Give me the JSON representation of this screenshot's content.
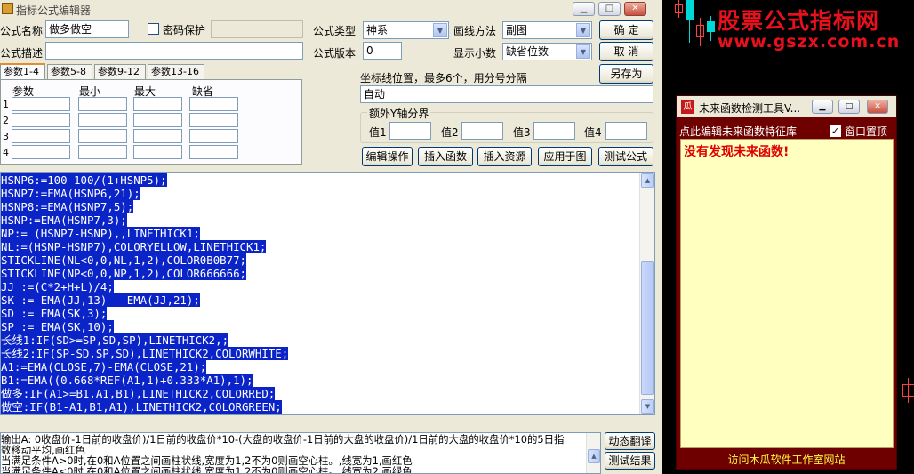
{
  "editor": {
    "title": "指标公式编辑器",
    "win_buttons": {
      "minimize": "▁",
      "maximize": "□",
      "close": "✕"
    },
    "name_label": "公式名称",
    "name_value": "做多做空",
    "password_label": "密码保护",
    "type_label": "公式类型",
    "type_value": "神系",
    "draw_label": "画线方法",
    "draw_value": "副图",
    "ok_label": "确  定",
    "desc_label": "公式描述",
    "version_label": "公式版本",
    "version_value": "0",
    "decimals_label": "显示小数",
    "decimals_value": "缺省位数",
    "cancel_label": "取  消",
    "saveas_label": "另存为",
    "tabs": [
      "参数1-4",
      "参数5-8",
      "参数9-12",
      "参数13-16"
    ],
    "param_headers": [
      "参数",
      "最小",
      "最大",
      "缺省"
    ],
    "param_rows": [
      "1",
      "2",
      "3",
      "4"
    ],
    "coord_label": "坐标线位置，最多6个，用分号分隔",
    "coord_value": "自动",
    "yaxis_group": "额外Y轴分界",
    "yaxis_values": [
      "值1",
      "值2",
      "值3",
      "值4"
    ],
    "buttons": [
      "编辑操作",
      "插入函数",
      "插入资源",
      "应用于图",
      "测试公式"
    ],
    "code_lines": [
      "HSNP6:=100-100/(1+HSNP5);",
      "HSNP7:=EMA(HSNP6,21);",
      "HSNP8:=EMA(HSNP7,5);",
      "HSNP:=EMA(HSNP7,3);",
      "NP:= (HSNP7-HSNP),,LINETHICK1;",
      "NL:=(HSNP-HSNP7),COLORYELLOW,LINETHICK1;",
      "STICKLINE(NL<0,0,NL,1,2),COLOR0B0B77;",
      "STICKLINE(NP<0,0,NP,1,2),COLOR666666;",
      "JJ :=(C*2+H+L)/4;",
      "SK := EMA(JJ,13) - EMA(JJ,21);",
      "SD := EMA(SK,3);",
      "SP := EMA(SK,10);",
      "长线1:IF(SD>=SP,SD,SP),LINETHICK2,;",
      "长线2:IF(SP-SD,SP,SD),LINETHICK2,COLORWHITE;",
      "A1:=EMA(CLOSE,7)-EMA(CLOSE,21);",
      "B1:=EMA((0.668*REF(A1,1)+0.333*A1),1);",
      "做多:IF(A1>=B1,A1,B1),LINETHICK2,COLORRED;",
      "做空:IF(B1-A1,B1,A1),LINETHICK2,COLORGREEN;"
    ],
    "output_lines": [
      "输出A: 0收盘价-1日前的收盘价)/1日前的收盘价*10-(大盘的收盘价-1日前的大盘的收盘价)/1日前的大盘的收盘价*10的5日指",
      "数移动平均,画红色",
      "当满足条件A>0时,在0和A位置之间画柱状线,宽度为1,2不为0则画空心柱。,线宽为1,画红色",
      "当满足条件A<0时,在0和A位置之间画柱状线,宽度为1,2不为0则画空心柱。,线宽为2,画绿色"
    ],
    "dynamic_translate": "动态翻译",
    "test_result": "测试结果"
  },
  "brand": {
    "name": "股票公式指标网",
    "url": "www.gszx.com.cn"
  },
  "tool": {
    "logo": "瓜",
    "title": "未来函数检测工具V...",
    "header": "点此编辑未来函数特征库",
    "pin_label": "窗口置顶",
    "message": "没有发现未来函数!",
    "footer": "访问木瓜软件工作室网站"
  },
  "colors": {
    "selection": "#0a24c8",
    "brand_red": "#e8101c",
    "tool_bg": "#6e0000",
    "tool_pane": "#ffffc0"
  }
}
